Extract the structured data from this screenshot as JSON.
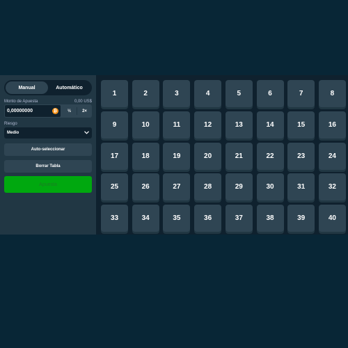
{
  "mode": {
    "manual": "Manual",
    "auto": "Automático"
  },
  "bet_amount": {
    "label": "Monto de Apuesta",
    "usd": "0,00 US$",
    "value": "0,00000000",
    "coin": "₿",
    "half": "½",
    "double": "2×"
  },
  "risk": {
    "label": "Riesgo",
    "value": "Medio",
    "chevron": "⌄"
  },
  "actions": {
    "auto_pick": "Auto-seleccionar",
    "clear_table": "Borrar Tabla",
    "bet": "Apuesta"
  },
  "tiles": [
    "1",
    "2",
    "3",
    "4",
    "5",
    "6",
    "7",
    "8",
    "9",
    "10",
    "11",
    "12",
    "13",
    "14",
    "15",
    "16",
    "17",
    "18",
    "19",
    "20",
    "21",
    "22",
    "23",
    "24",
    "25",
    "26",
    "27",
    "28",
    "29",
    "30",
    "31",
    "32",
    "33",
    "34",
    "35",
    "36",
    "37",
    "38",
    "39",
    "40"
  ]
}
